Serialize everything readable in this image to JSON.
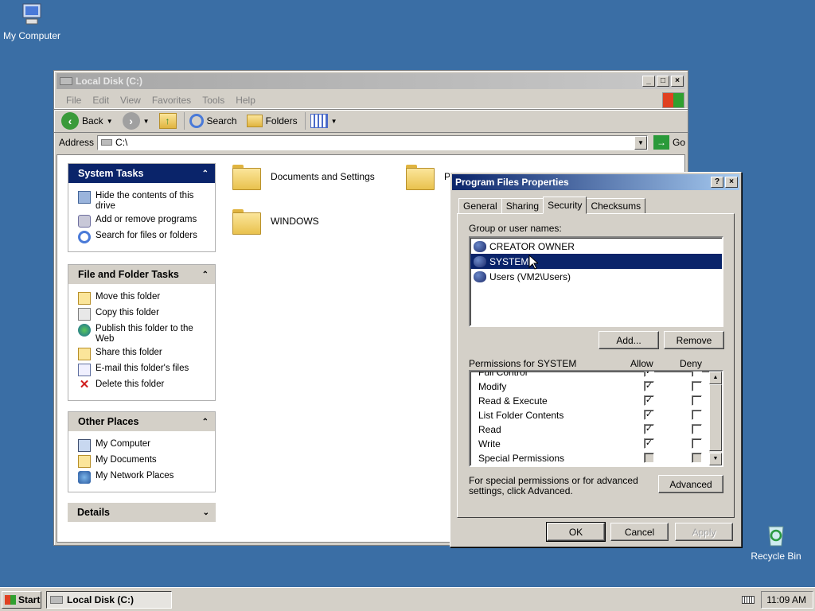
{
  "desktop": {
    "my_computer": "My Computer",
    "recycle_bin": "Recycle Bin"
  },
  "explorer": {
    "title": "Local Disk (C:)",
    "menu": [
      "File",
      "Edit",
      "View",
      "Favorites",
      "Tools",
      "Help"
    ],
    "toolbar": {
      "back": "Back",
      "search": "Search",
      "folders": "Folders"
    },
    "address_label": "Address",
    "address_value": "C:\\",
    "go": "Go",
    "system_tasks": {
      "title": "System Tasks",
      "items": [
        "Hide the contents of this drive",
        "Add or remove programs",
        "Search for files or folders"
      ]
    },
    "file_tasks": {
      "title": "File and Folder Tasks",
      "items": [
        "Move this folder",
        "Copy this folder",
        "Publish this folder to the Web",
        "Share this folder",
        "E-mail this folder's files",
        "Delete this folder"
      ]
    },
    "other_places": {
      "title": "Other Places",
      "items": [
        "My Computer",
        "My Documents",
        "My Network Places"
      ]
    },
    "details": {
      "title": "Details"
    },
    "folders": [
      "Documents and Settings",
      "WINDOWS",
      "Pr"
    ]
  },
  "dialog": {
    "title": "Program Files Properties",
    "tabs": [
      "General",
      "Sharing",
      "Security",
      "Checksums"
    ],
    "selected_tab": "Security",
    "group_label": "Group or user names:",
    "users": [
      "CREATOR OWNER",
      "SYSTEM",
      "Users (VM2\\Users)"
    ],
    "selected_user": "SYSTEM",
    "add": "Add...",
    "remove": "Remove",
    "perm_label": "Permissions for SYSTEM",
    "allow": "Allow",
    "deny": "Deny",
    "permissions": [
      {
        "name": "Full Control",
        "allow": true,
        "deny": false
      },
      {
        "name": "Modify",
        "allow": true,
        "deny": false
      },
      {
        "name": "Read & Execute",
        "allow": true,
        "deny": false
      },
      {
        "name": "List Folder Contents",
        "allow": true,
        "deny": false
      },
      {
        "name": "Read",
        "allow": true,
        "deny": false
      },
      {
        "name": "Write",
        "allow": true,
        "deny": false
      },
      {
        "name": "Special Permissions",
        "allow": false,
        "deny": false
      }
    ],
    "advanced_text": "For special permissions or for advanced settings, click Advanced.",
    "advanced": "Advanced",
    "ok": "OK",
    "cancel": "Cancel",
    "apply": "Apply"
  },
  "taskbar": {
    "start": "Start",
    "task": "Local Disk (C:)",
    "clock": "11:09 AM"
  }
}
